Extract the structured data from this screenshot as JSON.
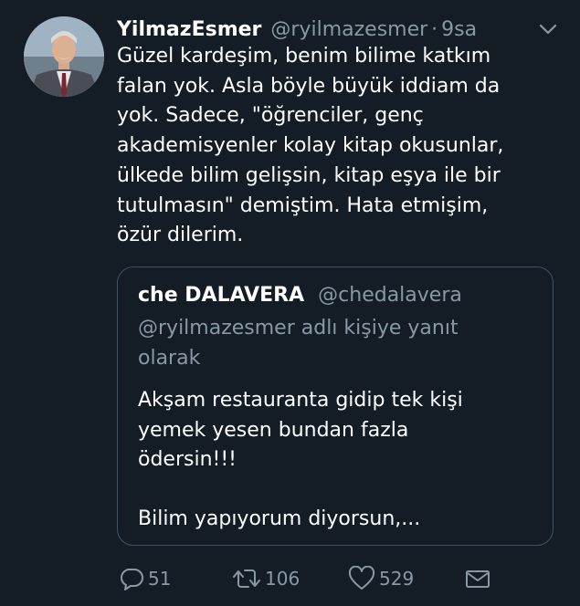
{
  "tweet": {
    "display_name": "YilmazEsmer",
    "handle": "@ryilmazesmer",
    "separator": "·",
    "time": "9sa",
    "text": "Güzel kardeşim, benim bilime katkım\nfalan yok. Asla böyle büyük iddiam da\nyok. Sadece, \"öğrenciler, genç\nakademisyenler kolay kitap okusunlar,\nülkede bilim gelişsin, kitap  eşya ile bir\ntutulmasın\" demiştim. Hata etmişim,\nözür dilerim."
  },
  "quote": {
    "display_name": "che DALAVERA",
    "handle": "@chedalavera",
    "reply_context": "@ryilmazesmer adlı kişiye yanıt olarak",
    "text": "Akşam restauranta gidip tek kişi\nyemek yesen bundan fazla\nödersin!!!\n\nBilim yapıyorum diyorsun,..."
  },
  "actions": {
    "reply_count": "51",
    "retweet_count": "106",
    "like_count": "529"
  },
  "icons": {
    "reply": "reply-icon",
    "retweet": "retweet-icon",
    "like": "heart-icon",
    "dm": "envelope-icon",
    "menu": "chevron-down-icon"
  },
  "colors": {
    "background": "#141d26",
    "text": "#ffffff",
    "muted": "#8899a6",
    "border": "#3d5466"
  }
}
